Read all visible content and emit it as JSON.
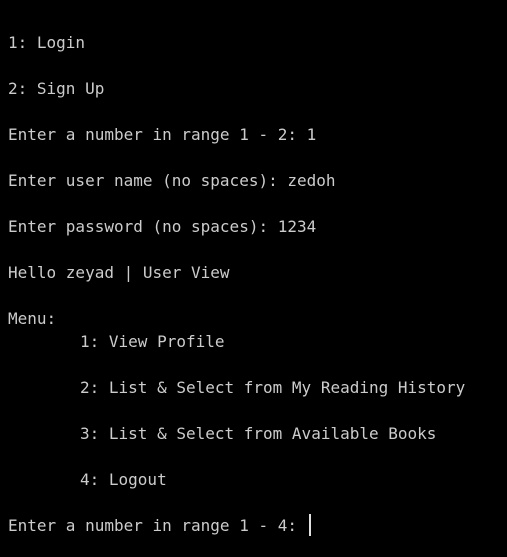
{
  "terminal": {
    "lines": {
      "login": "1: Login",
      "signup": "2: Sign Up",
      "range_prompt_1": "Enter a number in range 1 - 2: 1",
      "username_prompt": "Enter user name (no spaces): zedoh",
      "password_prompt": "Enter password (no spaces): 1234",
      "greeting": "Hello zeyad | User View",
      "menu_header": "Menu:",
      "menu_1": "1: View Profile",
      "menu_2": "2: List & Select from My Reading History",
      "menu_3": "3: List & Select from Available Books",
      "menu_4": "4: Logout",
      "range_prompt_2": "Enter a number in range 1 - 4: "
    }
  }
}
